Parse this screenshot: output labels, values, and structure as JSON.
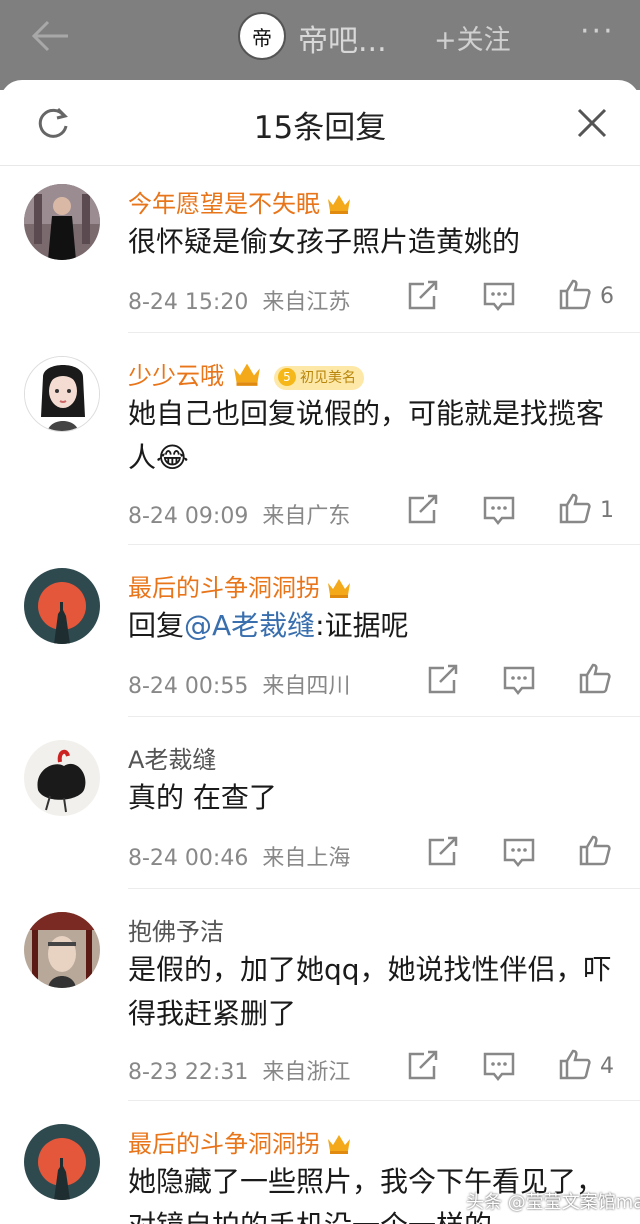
{
  "background": {
    "back_icon": "arrow-left-icon",
    "logo_text": "帝",
    "title": "帝吧...",
    "follow_label": "+关注",
    "more_label": "···"
  },
  "sheet": {
    "title": "15条回复",
    "refresh_icon": "refresh-icon",
    "close_icon": "close-icon"
  },
  "comments": [
    {
      "name": "今年愿望是不失眠",
      "text": "很怀疑是偷女孩子照片造黄姚的",
      "time": "8-24 15:20",
      "location": "来自江苏",
      "likes": "6"
    },
    {
      "name": "少少云哦",
      "badge_num": "5",
      "badge_label": "初见美名",
      "text": "她自己也回复说假的，可能就是找揽客人😂",
      "time": "8-24 09:09",
      "location": "来自广东",
      "likes": "1"
    },
    {
      "name": "最后的斗争洞洞拐",
      "text_prefix": "回复",
      "mention": "@A老裁缝",
      "text_suffix": ":证据呢",
      "time": "8-24 00:55",
      "location": "来自四川",
      "likes": ""
    },
    {
      "name": "A老裁缝",
      "text": "真的 在查了",
      "time": "8-24 00:46",
      "location": "来自上海",
      "likes": ""
    },
    {
      "name": "抱佛予洁",
      "text": "是假的，加了她qq，她说找性伴侣，吓得我赶紧删了",
      "time": "8-23 22:31",
      "location": "来自浙江",
      "likes": "4"
    },
    {
      "name": "最后的斗争洞洞拐",
      "text": "她隐藏了一些照片，我今下午看见了，对镜自拍的手机没一个一样的",
      "time": "",
      "location": "",
      "likes": ""
    }
  ],
  "watermark": "头条 @莹莹文案馆ma",
  "colors": {
    "username_vip": "#e8751a",
    "mention": "#3a6fae",
    "meta": "#888888"
  }
}
